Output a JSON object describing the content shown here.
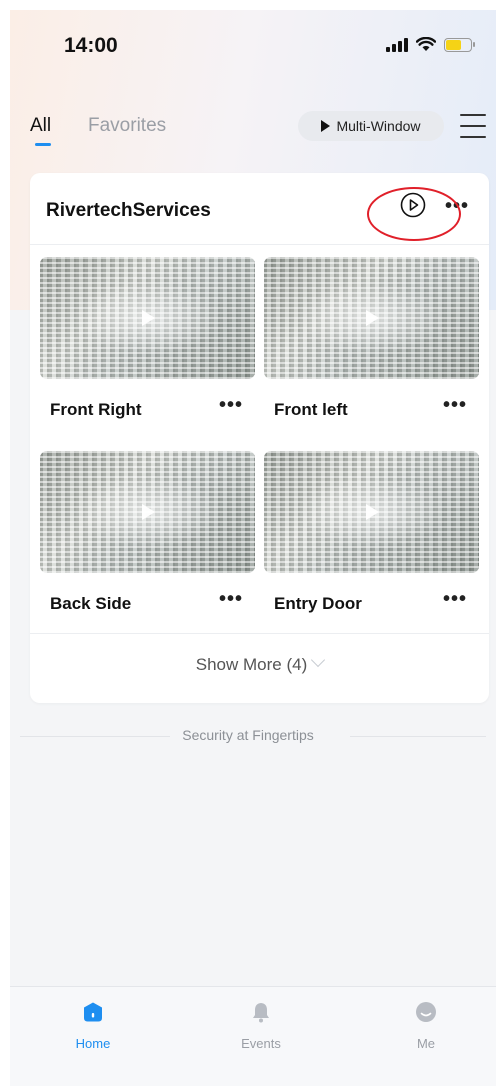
{
  "status_bar": {
    "time": "14:00"
  },
  "colors": {
    "accent": "#1e8ef0",
    "battery": "#f5d316",
    "highlight_ring": "#e0202a",
    "inactive": "#b8bcc3"
  },
  "tabs": {
    "all": "All",
    "favorites": "Favorites",
    "multi_window": "Multi-Window"
  },
  "group": {
    "title": "RivertechServices",
    "cameras": [
      {
        "name": "Front Right"
      },
      {
        "name": "Front left"
      },
      {
        "name": "Back Side"
      },
      {
        "name": "Entry Door"
      }
    ],
    "show_more": "Show More (4)"
  },
  "tagline": "Security at Fingertips",
  "bottom_nav": [
    {
      "label": "Home",
      "icon": "home-icon",
      "active": true
    },
    {
      "label": "Events",
      "icon": "bell-icon",
      "active": false
    },
    {
      "label": "Me",
      "icon": "profile-icon",
      "active": false
    }
  ]
}
